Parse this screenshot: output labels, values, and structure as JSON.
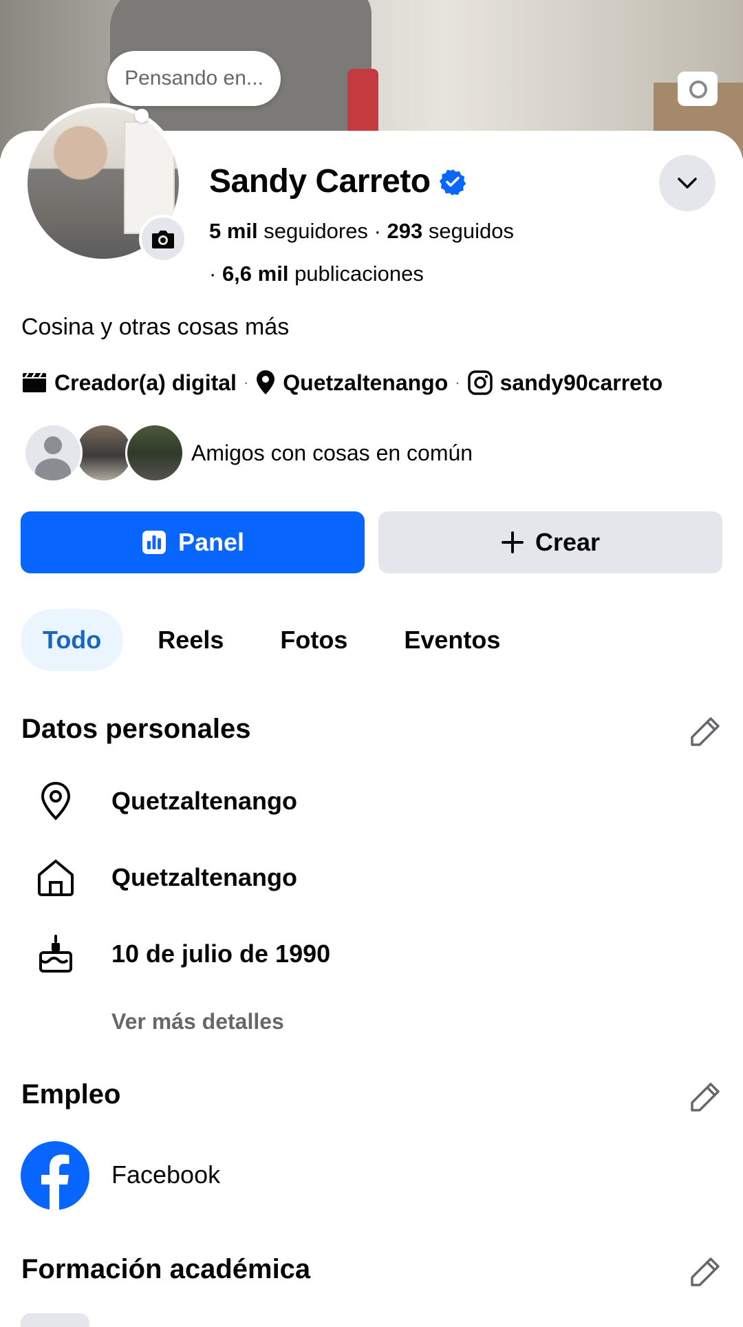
{
  "profile": {
    "bubble_text": "Pensando en...",
    "name": "Sandy Carreto",
    "followers_count": "5 mil",
    "followers_label": "seguidores",
    "following_count": "293",
    "following_label": "seguidos",
    "posts_count": "6,6 mil",
    "posts_label": "publicaciones",
    "bio": "Cosina y otras cosas más",
    "category": "Creador(a) digital",
    "location": "Quetzaltenango",
    "instagram": "sandy90carreto",
    "friends_text": "Amigos con cosas en común"
  },
  "actions": {
    "panel_label": "Panel",
    "create_label": "Crear"
  },
  "tabs": [
    {
      "label": "Todo",
      "active": true
    },
    {
      "label": "Reels",
      "active": false
    },
    {
      "label": "Fotos",
      "active": false
    },
    {
      "label": "Eventos",
      "active": false
    }
  ],
  "personal": {
    "title": "Datos personales",
    "current_city": "Quetzaltenango",
    "hometown": "Quetzaltenango",
    "birthday": "10 de julio de 1990",
    "more_details": "Ver más detalles"
  },
  "employment": {
    "title": "Empleo",
    "employer": "Facebook"
  },
  "education": {
    "title": "Formación académica"
  },
  "colors": {
    "accent": "#0866ff",
    "secondary_button": "#e4e6eb",
    "tab_active_bg": "#ebf5ff",
    "muted_text": "#65676b"
  },
  "icons": [
    "camera-icon",
    "verified-badge-icon",
    "chevron-down-icon",
    "clapperboard-icon",
    "location-pin-icon",
    "instagram-icon",
    "dashboard-icon",
    "plus-icon",
    "pencil-icon",
    "home-icon",
    "cake-icon",
    "facebook-logo-icon"
  ]
}
